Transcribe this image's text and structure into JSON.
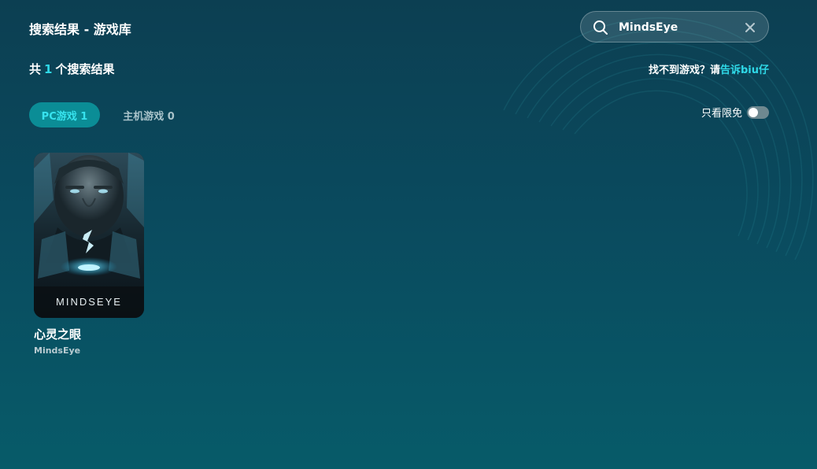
{
  "header": {
    "title": "搜索结果 - 游戏库"
  },
  "search": {
    "value": "MindsEye",
    "icon": "search-icon",
    "clear_icon": "close-icon"
  },
  "results": {
    "prefix": "共",
    "count": "1",
    "suffix": "个搜索结果"
  },
  "feedback": {
    "text": "找不到游戏？请",
    "link": "告诉biu仔"
  },
  "tabs": [
    {
      "label": "PC游戏 1",
      "active": true
    },
    {
      "label": "主机游戏 0",
      "active": false
    }
  ],
  "filter": {
    "label": "只看限免",
    "enabled": false
  },
  "games": [
    {
      "title": "心灵之眼",
      "subtitle": "MindsEye",
      "cover_logo": "MINDSEYE"
    }
  ],
  "colors": {
    "accent": "#2fd9e8",
    "active_tab_bg": "#0b8d96",
    "background_top": "#0c3f52",
    "background_bottom": "#075b69"
  }
}
